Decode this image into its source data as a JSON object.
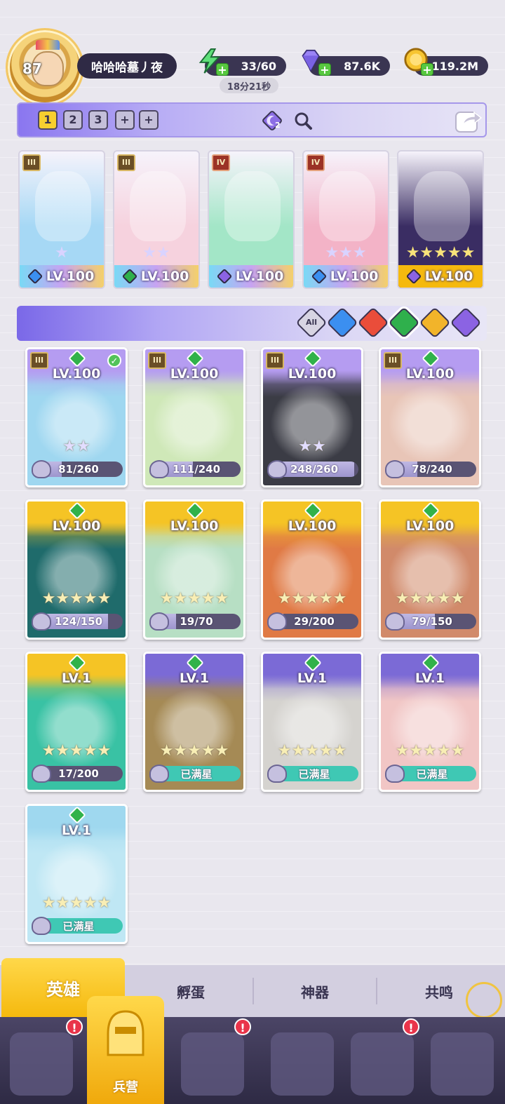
{
  "player": {
    "level": "87",
    "name": "哈哈哈墓丿夜"
  },
  "resources": {
    "energy": "33/60",
    "energy_timer": "18分21秒",
    "gems": "87.6K",
    "gold": "119.2M"
  },
  "team_tabs": [
    "1",
    "2",
    "3",
    "+",
    "+"
  ],
  "team_badge_count": "2",
  "team": [
    {
      "tier": "III",
      "level": "LV.100",
      "stars": 1,
      "element": "water",
      "bg": "#a6d8f5"
    },
    {
      "tier": "III",
      "level": "LV.100",
      "stars": 2,
      "element": "nature",
      "bg": "#f6d2de"
    },
    {
      "tier": "IV",
      "level": "LV.100",
      "stars": 0,
      "element": "dark",
      "bg": "#a3e6c7"
    },
    {
      "tier": "IV",
      "level": "LV.100",
      "stars": 3,
      "element": "water",
      "bg": "#f3b3c7"
    },
    {
      "tier": "",
      "level": "LV.100",
      "stars": 5,
      "element": "dark",
      "bg": "#3a2d63"
    }
  ],
  "filters": [
    "All",
    "water",
    "fire",
    "nature",
    "light",
    "dark"
  ],
  "filter_all_label": "All",
  "heroes": [
    {
      "tier": "III",
      "level": "LV.100",
      "stars": 2,
      "progress": "81/260",
      "ratio": 0.31,
      "color": "#9fd7f0",
      "head": "#b59cf1",
      "checked": true
    },
    {
      "tier": "III",
      "level": "LV.100",
      "stars": 0,
      "progress": "111/240",
      "ratio": 0.46,
      "color": "#cfe8b8",
      "head": "#b59cf1",
      "checked": false
    },
    {
      "tier": "III",
      "level": "LV.100",
      "stars": 2,
      "progress": "248/260",
      "ratio": 0.95,
      "color": "#3b3c45",
      "head": "#b59cf1",
      "checked": false
    },
    {
      "tier": "III",
      "level": "LV.100",
      "stars": 0,
      "progress": "78/240",
      "ratio": 0.33,
      "color": "#e8c5b7",
      "head": "#b59cf1",
      "checked": false
    },
    {
      "tier": "",
      "level": "LV.100",
      "stars": 5,
      "progress": "124/150",
      "ratio": 0.83,
      "color": "#1f6b6b",
      "head": "#f5c425",
      "checked": false
    },
    {
      "tier": "",
      "level": "LV.100",
      "stars": 5,
      "progress": "19/70",
      "ratio": 0.27,
      "color": "#b7dfc4",
      "head": "#f5c425",
      "checked": false
    },
    {
      "tier": "",
      "level": "LV.100",
      "stars": 5,
      "progress": "29/200",
      "ratio": 0.15,
      "color": "#e07a45",
      "head": "#f5c425",
      "checked": false
    },
    {
      "tier": "",
      "level": "LV.100",
      "stars": 5,
      "progress": "79/150",
      "ratio": 0.53,
      "color": "#d18a6a",
      "head": "#f5c425",
      "checked": false
    },
    {
      "tier": "",
      "level": "LV.1",
      "stars": 5,
      "progress": "17/200",
      "ratio": 0.09,
      "color": "#39c2a4",
      "head": "#f5c425",
      "checked": false
    },
    {
      "tier": "",
      "level": "LV.1",
      "stars": 5,
      "progress": "已满星",
      "ratio": 1,
      "color": "#a58a55",
      "head": "#7b6ad6",
      "checked": false
    },
    {
      "tier": "",
      "level": "LV.1",
      "stars": 5,
      "progress": "已满星",
      "ratio": 1,
      "color": "#d5d3cf",
      "head": "#7b6ad6",
      "checked": false
    },
    {
      "tier": "",
      "level": "LV.1",
      "stars": 5,
      "progress": "已满星",
      "ratio": 1,
      "color": "#f1c6c5",
      "head": "#7b6ad6",
      "checked": false
    },
    {
      "tier": "",
      "level": "LV.1",
      "stars": 5,
      "progress": "已满星",
      "ratio": 1,
      "color": "#bfe7f4",
      "head": "#9fd8ef",
      "checked": false
    }
  ],
  "sub_tabs": [
    "英雄",
    "孵蛋",
    "神器",
    "共鸣"
  ],
  "nav": {
    "active_label": "兵营"
  }
}
